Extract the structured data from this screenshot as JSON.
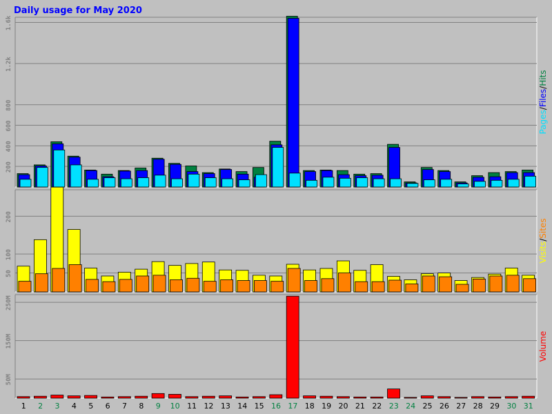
{
  "title": "Daily usage for May 2020",
  "colors": {
    "background": "#c0c0c0",
    "title": "#0000ff",
    "grid": "#808080",
    "axis_text": "#000000",
    "weekend_day": "#008040",
    "tick_gray": "#808080",
    "hits": "#008040",
    "files": "#0000ff",
    "pages": "#00e0ff",
    "visits": "#ffff00",
    "sites": "#ff8000",
    "volume": "#ff0000"
  },
  "chart_data": [
    {
      "type": "bar",
      "panel": "hits-files-pages",
      "legend": [
        "Pages",
        "/",
        "Files",
        "/",
        "Hits"
      ],
      "legend_placement": "right-vertical",
      "grid": true,
      "ylim": [
        0,
        1650
      ],
      "yticks": [
        {
          "value": 200,
          "label": "200"
        },
        {
          "value": 400,
          "label": "400"
        },
        {
          "value": 600,
          "label": "600"
        },
        {
          "value": 800,
          "label": "800"
        },
        {
          "value": 1200,
          "label": "1.2k"
        },
        {
          "value": 1600,
          "label": "1.6k"
        }
      ],
      "categories": [
        "1",
        "2",
        "3",
        "4",
        "5",
        "6",
        "7",
        "8",
        "9",
        "10",
        "11",
        "12",
        "13",
        "14",
        "15",
        "16",
        "17",
        "18",
        "19",
        "20",
        "21",
        "22",
        "23",
        "24",
        "25",
        "26",
        "27",
        "28",
        "29",
        "30",
        "31"
      ],
      "series": [
        {
          "name": "Hits",
          "values": [
            130,
            215,
            440,
            300,
            165,
            125,
            160,
            185,
            280,
            230,
            205,
            140,
            175,
            150,
            190,
            445,
            1660,
            160,
            165,
            160,
            125,
            130,
            415,
            50,
            190,
            160,
            50,
            110,
            140,
            150,
            165
          ]
        },
        {
          "name": "Files",
          "values": [
            120,
            205,
            420,
            290,
            160,
            100,
            155,
            160,
            270,
            220,
            150,
            130,
            170,
            125,
            95,
            410,
            1640,
            150,
            160,
            120,
            110,
            115,
            385,
            40,
            170,
            150,
            40,
            95,
            100,
            140,
            140
          ]
        },
        {
          "name": "Pages",
          "values": [
            75,
            190,
            360,
            215,
            75,
            90,
            80,
            90,
            115,
            80,
            125,
            90,
            80,
            70,
            120,
            385,
            135,
            65,
            95,
            85,
            90,
            80,
            80,
            35,
            70,
            75,
            30,
            55,
            65,
            75,
            105
          ]
        }
      ]
    },
    {
      "type": "bar",
      "panel": "visits-sites",
      "legend": [
        "Visits",
        "/",
        "Sites"
      ],
      "legend_placement": "right-vertical",
      "grid": true,
      "ylim": [
        0,
        270
      ],
      "yticks": [
        {
          "value": 50,
          "label": "50"
        },
        {
          "value": 100,
          "label": "100"
        },
        {
          "value": 200,
          "label": "200"
        }
      ],
      "categories": [
        "1",
        "2",
        "3",
        "4",
        "5",
        "6",
        "7",
        "8",
        "9",
        "10",
        "11",
        "12",
        "13",
        "14",
        "15",
        "16",
        "17",
        "18",
        "19",
        "20",
        "21",
        "22",
        "23",
        "24",
        "25",
        "26",
        "27",
        "28",
        "29",
        "30",
        "31"
      ],
      "series": [
        {
          "name": "Visits",
          "values": [
            68,
            138,
            277,
            165,
            63,
            42,
            52,
            60,
            80,
            70,
            75,
            79,
            58,
            57,
            44,
            42,
            73,
            58,
            62,
            82,
            57,
            72,
            41,
            32,
            48,
            50,
            30,
            38,
            47,
            63,
            44
          ]
        },
        {
          "name": "Sites",
          "values": [
            28,
            48,
            62,
            72,
            33,
            27,
            33,
            42,
            44,
            32,
            36,
            28,
            32,
            30,
            30,
            28,
            62,
            30,
            35,
            50,
            27,
            27,
            31,
            21,
            42,
            40,
            20,
            34,
            42,
            44,
            35
          ]
        }
      ]
    },
    {
      "type": "bar",
      "panel": "volume",
      "legend": [
        "Volume"
      ],
      "legend_placement": "right-vertical",
      "grid": true,
      "ylim": [
        0,
        270
      ],
      "ylabel_unit": "M",
      "yticks": [
        {
          "value": 50,
          "label": "50M"
        },
        {
          "value": 150,
          "label": "150M"
        },
        {
          "value": 250,
          "label": "250M"
        }
      ],
      "categories": [
        "1",
        "2",
        "3",
        "4",
        "5",
        "6",
        "7",
        "8",
        "9",
        "10",
        "11",
        "12",
        "13",
        "14",
        "15",
        "16",
        "17",
        "18",
        "19",
        "20",
        "21",
        "22",
        "23",
        "24",
        "25",
        "26",
        "27",
        "28",
        "29",
        "30",
        "31"
      ],
      "series": [
        {
          "name": "Volume",
          "values": [
            4,
            5,
            8,
            6,
            7,
            3,
            4,
            5,
            12,
            10,
            4,
            5,
            6,
            3,
            4,
            9,
            266,
            6,
            5,
            4,
            3,
            3,
            24,
            2,
            6,
            4,
            2,
            4,
            3,
            4,
            5
          ]
        }
      ]
    }
  ],
  "x_axis": {
    "labels": [
      "1",
      "2",
      "3",
      "4",
      "5",
      "6",
      "7",
      "8",
      "9",
      "10",
      "11",
      "12",
      "13",
      "14",
      "15",
      "16",
      "17",
      "18",
      "19",
      "20",
      "21",
      "22",
      "23",
      "24",
      "25",
      "26",
      "27",
      "28",
      "29",
      "30",
      "31"
    ],
    "weekend_days": [
      "2",
      "3",
      "9",
      "10",
      "16",
      "17",
      "23",
      "24",
      "30",
      "31"
    ]
  }
}
